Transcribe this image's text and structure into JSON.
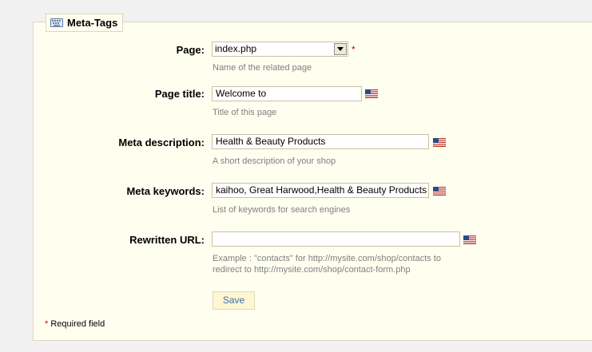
{
  "fieldset": {
    "title": "Meta-Tags",
    "icon": "keyboard-icon"
  },
  "fields": {
    "page": {
      "label": "Page:",
      "value": "index.php",
      "required_mark": "*",
      "hint": "Name of the related page"
    },
    "page_title": {
      "label": "Page title:",
      "value": "Welcome to",
      "hint": "Title of this page"
    },
    "meta_description": {
      "label": "Meta description:",
      "value": "Health & Beauty Products",
      "hint": "A short description of your shop"
    },
    "meta_keywords": {
      "label": "Meta keywords:",
      "value": "kaihoo, Great Harwood,Health & Beauty Products",
      "hint": "List of keywords for search engines"
    },
    "rewritten_url": {
      "label": "Rewritten URL:",
      "value": "",
      "hint_line1": "Example : \"contacts\" for http://mysite.com/shop/contacts to",
      "hint_line2": "redirect to http://mysite.com/shop/contact-form.php"
    }
  },
  "save_label": "Save",
  "required_note": {
    "star": "*",
    "text": " Required field"
  },
  "language_flag": "us-flag-icon"
}
